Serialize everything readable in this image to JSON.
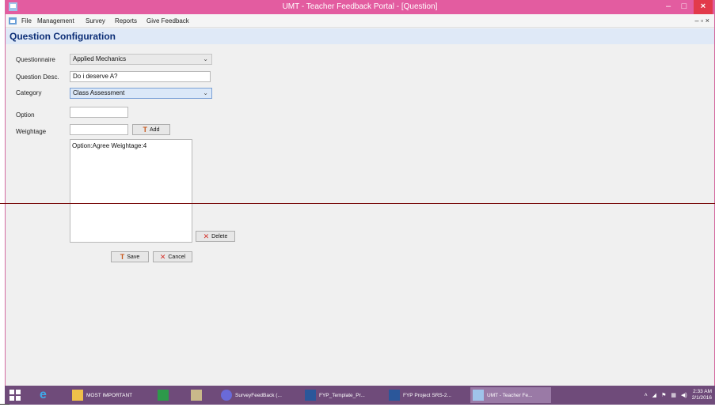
{
  "window": {
    "title": "UMT - Teacher Feedback Portal - [Question]",
    "controls": {
      "minimize": "–",
      "maximize": "□",
      "close": "×"
    }
  },
  "menubar": {
    "items": [
      "File",
      "Management",
      "Survey",
      "Reports",
      "Give Feedback"
    ],
    "mdi_controls": "– ▫ ×"
  },
  "form": {
    "title": "Question Configuration",
    "questionnaire": {
      "label": "Questionnaire",
      "value": "Applied Mechanics"
    },
    "question_desc": {
      "label": "Question Desc.",
      "value": "Do i deserve A?"
    },
    "category": {
      "label": "Category",
      "value": "Class Assessment"
    },
    "option": {
      "label": "Option",
      "value": ""
    },
    "weightage": {
      "label": "Weightage",
      "value": ""
    },
    "add_button": "Add",
    "options_list": [
      "Option:Agree Weightage:4"
    ],
    "delete_button": "Delete",
    "save_button": "Save",
    "cancel_button": "Cancel"
  },
  "taskbar": {
    "items": [
      "MOST IMPORTANT",
      "SurveyFeedBack (...",
      "FYP_Template_Pr...",
      "FYP Project SRS-2...",
      "UMT - Teacher Fe..."
    ],
    "time": "2:33 AM",
    "date": "2/1/2016"
  },
  "colors": {
    "titlebar": "#e35ca0",
    "header_text": "#0c2e76",
    "header_bg": "#dfe9f7",
    "taskbar": "#6f4b7a",
    "separator": "#7b0f0f"
  }
}
